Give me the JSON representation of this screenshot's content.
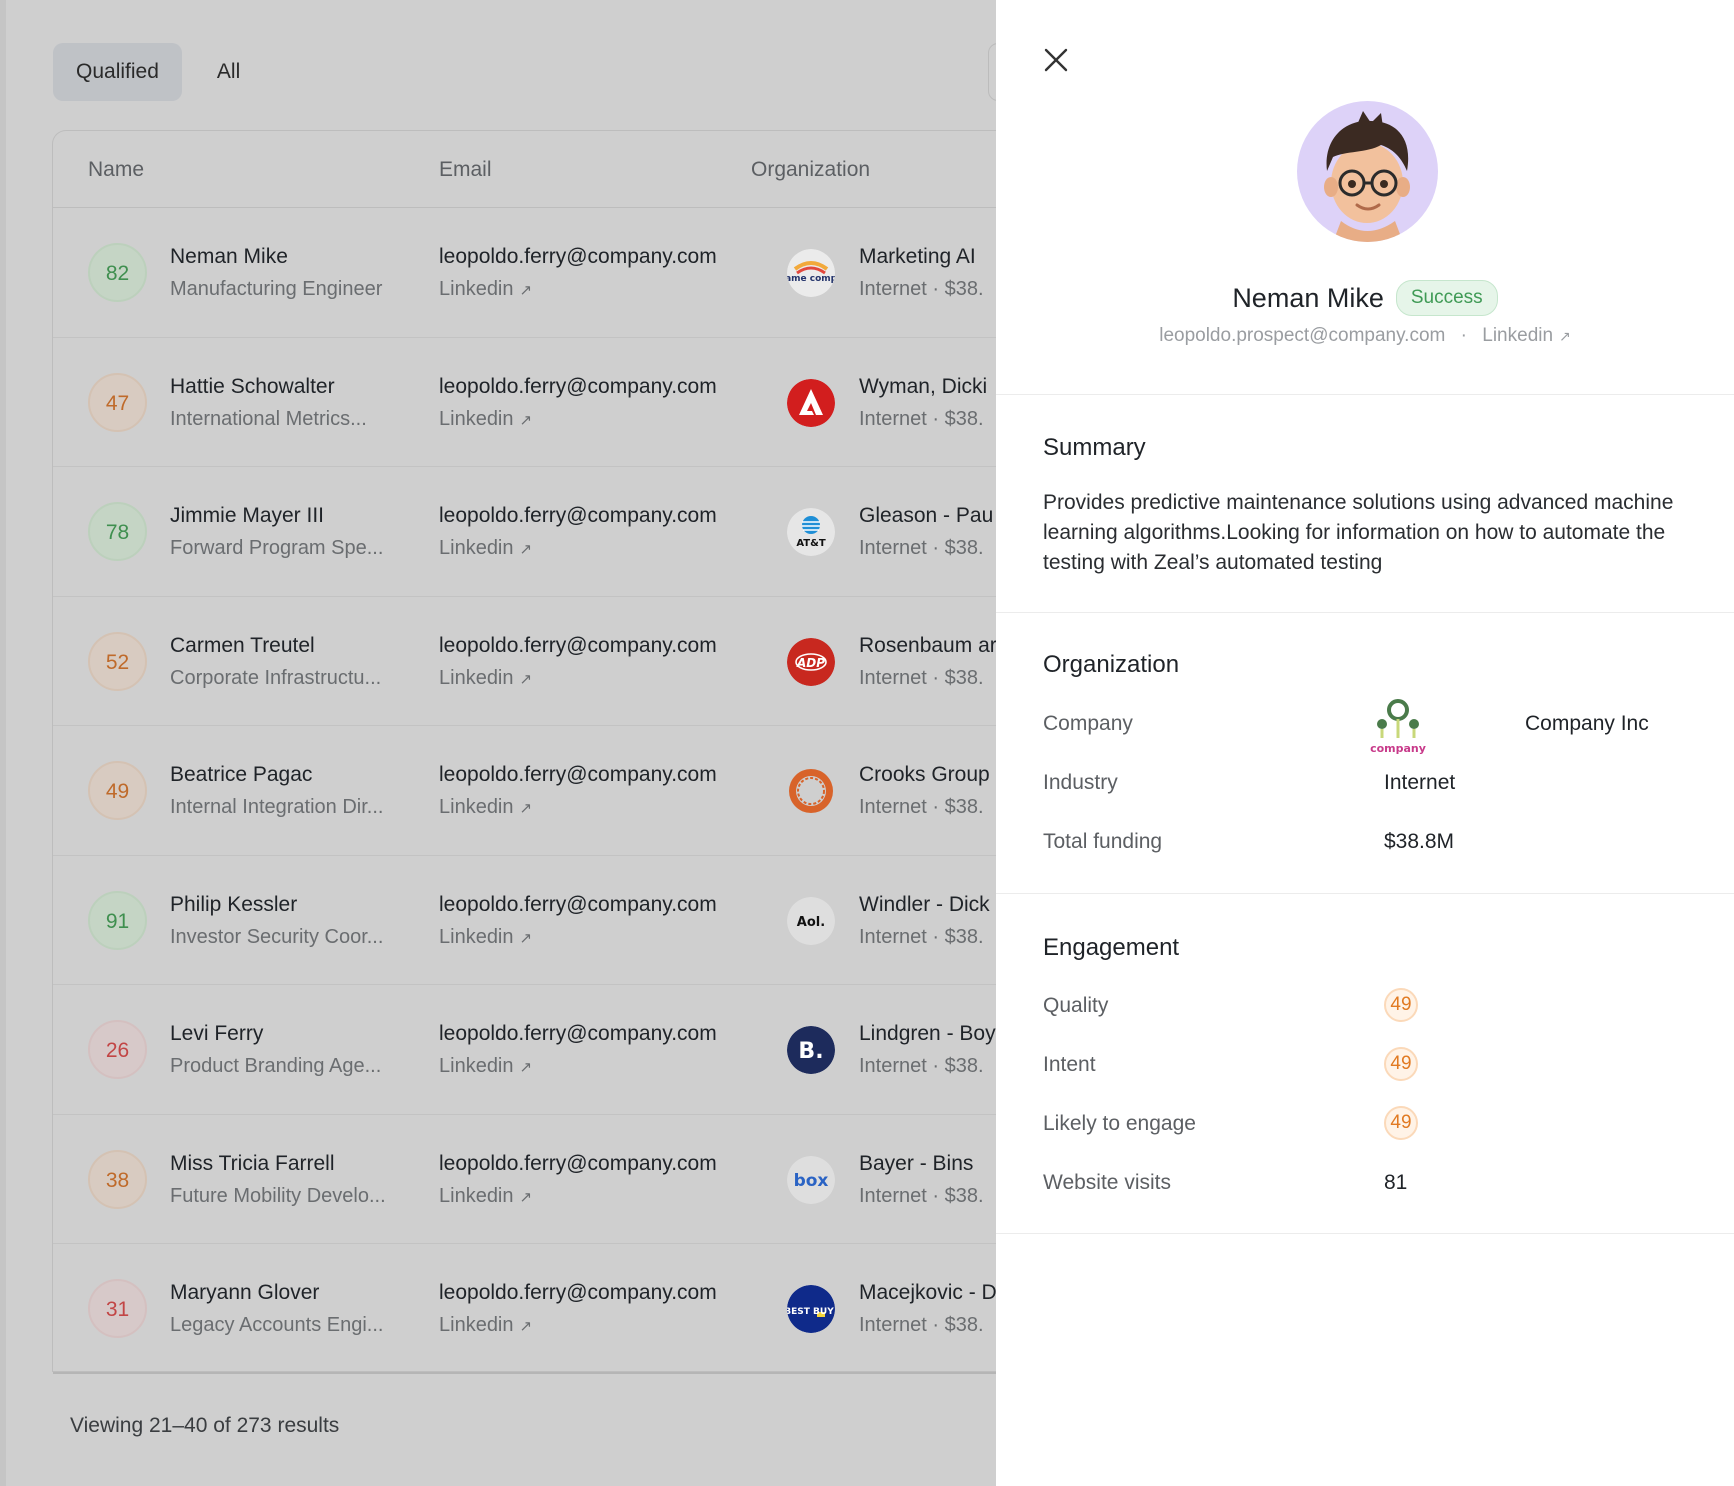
{
  "tabs": [
    {
      "label": "Qualified",
      "active": true
    },
    {
      "label": "All",
      "active": false
    }
  ],
  "table": {
    "headers": {
      "name": "Name",
      "email": "Email",
      "organization": "Organization"
    },
    "rows": [
      {
        "score": "82",
        "level": "green",
        "name": "Neman Mike",
        "title": "Manufacturing Engineer",
        "email": "leopoldo.ferry@company.com",
        "link": "Linkedin",
        "org": "Marketing AI",
        "meta": "Internet  ·  $38.",
        "logo": "nameco-logo"
      },
      {
        "score": "47",
        "level": "orange",
        "name": "Hattie Schowalter",
        "title": "International Metrics...",
        "email": "leopoldo.ferry@company.com",
        "link": "Linkedin",
        "org": "Wyman, Dicki",
        "meta": "Internet  ·  $38.",
        "logo": "adobe-logo"
      },
      {
        "score": "78",
        "level": "green",
        "name": "Jimmie Mayer III",
        "title": "Forward Program Spe...",
        "email": "leopoldo.ferry@company.com",
        "link": "Linkedin",
        "org": "Gleason - Pau",
        "meta": "Internet  ·  $38.",
        "logo": "att-logo"
      },
      {
        "score": "52",
        "level": "orange",
        "name": "Carmen Treutel",
        "title": "Corporate Infrastructu...",
        "email": "leopoldo.ferry@company.com",
        "link": "Linkedin",
        "org": "Rosenbaum ar",
        "meta": "Internet  ·  $38.",
        "logo": "adp-logo"
      },
      {
        "score": "49",
        "level": "orange",
        "name": "Beatrice Pagac",
        "title": "Internal Integration Dir...",
        "email": "leopoldo.ferry@company.com",
        "link": "Linkedin",
        "org": "Crooks Group",
        "meta": "Internet  ·  $38.",
        "logo": "gear-logo"
      },
      {
        "score": "91",
        "level": "green",
        "name": "Philip Kessler",
        "title": "Investor Security Coor...",
        "email": "leopoldo.ferry@company.com",
        "link": "Linkedin",
        "org": "Windler - Dick",
        "meta": "Internet  ·  $38.",
        "logo": "aol-logo"
      },
      {
        "score": "26",
        "level": "red",
        "name": "Levi Ferry",
        "title": "Product Branding Age...",
        "email": "leopoldo.ferry@company.com",
        "link": "Linkedin",
        "org": "Lindgren - Boy",
        "meta": "Internet  ·  $38.",
        "logo": "booking-logo"
      },
      {
        "score": "38",
        "level": "orange",
        "name": "Miss Tricia Farrell",
        "title": "Future Mobility Develo...",
        "email": "leopoldo.ferry@company.com",
        "link": "Linkedin",
        "org": "Bayer - Bins",
        "meta": "Internet  ·  $38.",
        "logo": "box-logo"
      },
      {
        "score": "31",
        "level": "red",
        "name": "Maryann Glover",
        "title": "Legacy Accounts Engi...",
        "email": "leopoldo.ferry@company.com",
        "link": "Linkedin",
        "org": "Macejkovic - D",
        "meta": "Internet  ·  $38.",
        "logo": "bestbuy-logo"
      }
    ]
  },
  "logo_text": {
    "nameco": "name compo",
    "att": "AT&T",
    "adp": "ADP",
    "aol": "Aol.",
    "booking": "B.",
    "box": "box",
    "bestbuy": "BEST BUY"
  },
  "footer": "Viewing 21–40 of 273 results",
  "panel": {
    "name": "Neman Mike",
    "status": "Success",
    "email": "leopoldo.prospect@company.com",
    "separator": "·",
    "link": "Linkedin",
    "summary_title": "Summary",
    "summary_text": "Provides predictive maintenance solutions using advanced machine learning algorithms.Looking for information on how to automate the testing with Zeal’s automated testing",
    "org_title": "Organization",
    "org": {
      "company_label": "Company",
      "company_logo_text": "company",
      "company_value": "Company Inc",
      "industry_label": "Industry",
      "industry_value": "Internet",
      "funding_label": "Total funding",
      "funding_value": "$38.8M"
    },
    "eng_title": "Engagement",
    "engagement": {
      "quality_label": "Quality",
      "quality_value": "49",
      "intent_label": "Intent",
      "intent_value": "49",
      "likely_label": "Likely to engage",
      "likely_value": "49",
      "visits_label": "Website visits",
      "visits_value": "81"
    }
  },
  "colors": {
    "overlay": "#cfcfcf",
    "success": "#3f9a55",
    "engagement": "#e17a22",
    "score_green": "#3f8f4f",
    "score_orange": "#bf6a2a",
    "score_red": "#c24545"
  }
}
